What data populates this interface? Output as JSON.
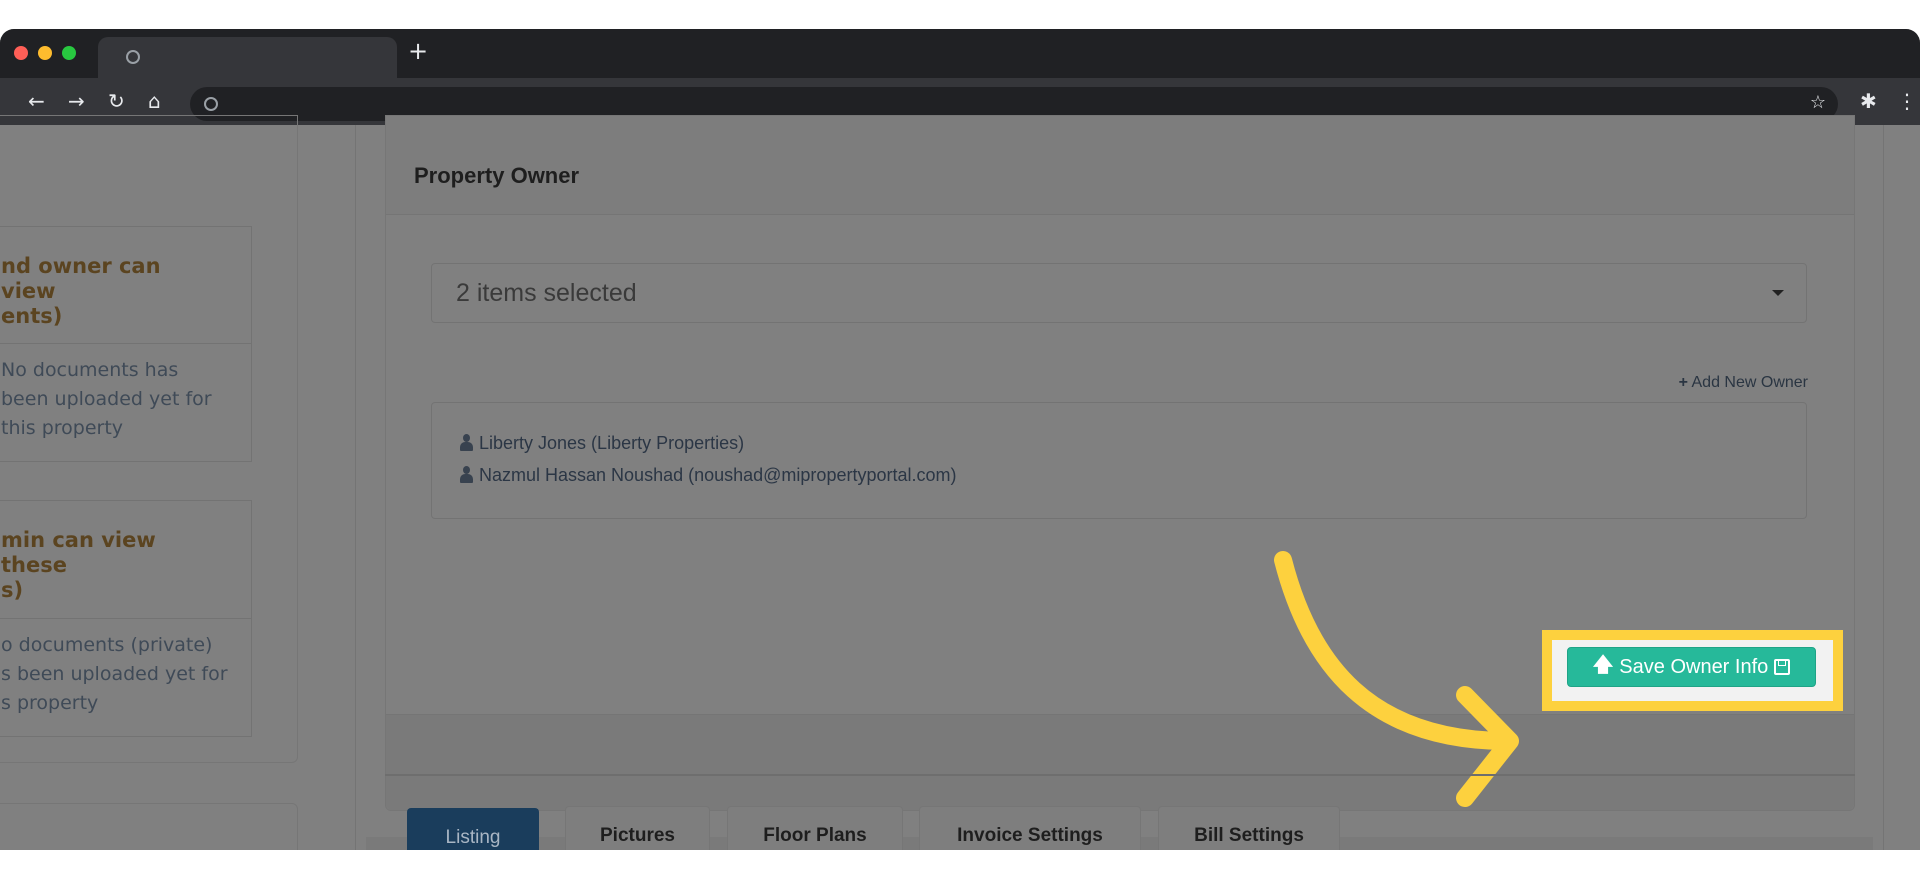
{
  "browser": {
    "new_tab": "+"
  },
  "left": {
    "box1": {
      "heading": [
        "nd owner can view",
        "ents)"
      ],
      "body": [
        "No documents has",
        "been uploaded yet for",
        "this property"
      ]
    },
    "box2": {
      "heading": [
        "min can view these",
        "s)"
      ],
      "body": [
        "o documents (private)",
        "s been uploaded yet for",
        "s property"
      ]
    }
  },
  "owner_panel": {
    "title": "Property Owner",
    "select_value": "2 items selected",
    "add_new_owner": "Add New Owner",
    "owners": [
      "Liberty Jones (Liberty Properties)",
      "Nazmul Hassan Noushad (noushad@mipropertyportal.com)"
    ],
    "save_button": "Save Owner Info"
  },
  "tabs": [
    "Listing",
    "Pictures",
    "Floor Plans",
    "Invoice Settings",
    "Bill Settings"
  ],
  "colors": {
    "accent": "#26b99a",
    "highlight": "#fdd13e",
    "active_tab": "#1a3d5c"
  }
}
